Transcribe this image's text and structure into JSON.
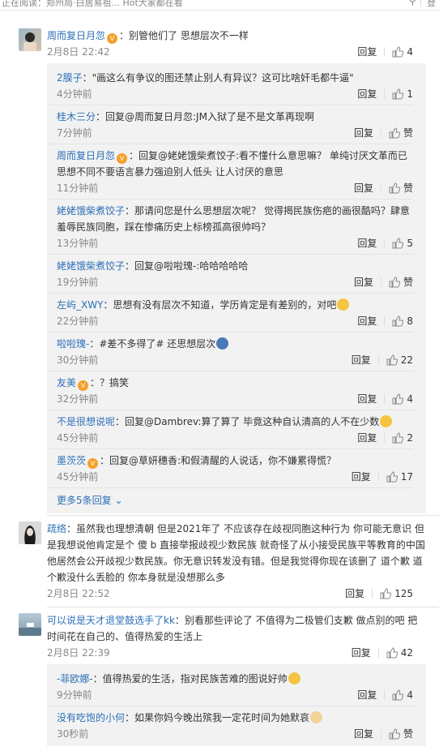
{
  "topbar": {
    "partial_title": "正在阅读：郑州局·白居易祖... Hot大家都在看",
    "right_label": "登"
  },
  "comments": [
    {
      "user": "周而复日月忽",
      "text": "：别管他们了 思想层次不一样",
      "time": "2月8日 22:42",
      "reply_label": "回复",
      "likes": "4",
      "replies": [
        {
          "user": "2膜子",
          "text": "：\"画这么有争议的图还禁止别人有异议？这可比啥奸毛都牛逼\"",
          "time": "4分钟前",
          "reply_label": "回复",
          "likes": "1"
        },
        {
          "user": "桂木三分",
          "text": "：回复@周而复日月忽:JM入狱了是不是文革再现啊",
          "time": "7分钟前",
          "reply_label": "回复",
          "likes": "赞"
        },
        {
          "user": "周而复日月忽",
          "text": "：回复@姥姥饿柴煮饺子:看不懂什么意思嘛？ 单纯讨厌文革而已 思想不同不要语言暴力强迫别人低头 让人讨厌的意思",
          "time": "11分钟前",
          "reply_label": "回复",
          "likes": "赞"
        },
        {
          "user": "姥姥饿柴煮饺子",
          "text": "：那请问您是什么思想层次呢？ 觉得揭民族伤疤的画很酷吗？肆意羞辱民族同胞，踩在惨痛历史上标榜孤高很帅吗？",
          "time": "13分钟前",
          "reply_label": "回复",
          "likes": "5"
        },
        {
          "user": "姥姥饿柴煮饺子",
          "text": "：回复@啦啦瑰-:哈哈哈哈哈",
          "time": "19分钟前",
          "reply_label": "回复",
          "likes": "赞"
        },
        {
          "user": "左屿_XWY",
          "text": "：思想有没有层次不知道，学历肯定是有差别的，对吧",
          "time": "22分钟前",
          "reply_label": "回复",
          "likes": "8"
        },
        {
          "user": "啦啦瑰-",
          "text": "：#差不多得了# 还思想层次",
          "time": "30分钟前",
          "reply_label": "回复",
          "likes": "22"
        },
        {
          "user": "友美",
          "text": "：？搞笑",
          "time": "32分钟前",
          "reply_label": "回复",
          "likes": "4"
        },
        {
          "user": "不是很想说呢",
          "text": "：回复@Dambrev:算了算了 毕竟这种自认清高的人不在少数",
          "time": "45分钟前",
          "reply_label": "回复",
          "likes": "2"
        },
        {
          "user": "墨茨茨",
          "text": "：回复@草妍穗香:和假清醒的人说话，你不嫌累得慌？",
          "time": "45分钟前",
          "reply_label": "回复",
          "likes": "17"
        }
      ],
      "more_label": "更多5条回复"
    },
    {
      "user": "疏络",
      "text": "：虽然我也理想清朝 但是2021年了 不应该存在歧视同胞这种行为 你可能无意识 但是我想说他肯定是个 傻 b 直接举报歧视少数民族 就奇怪了从小接受民族平等教育的中国他居然会公开歧视少数民族。你无意识转发没有错。但是我觉得你现在该删了 道个歉 道个歉没什么丢脸的 你本身就是没想那么多",
      "time": "2月8日 22:52",
      "reply_label": "回复",
      "likes": "125"
    },
    {
      "user": "可以说是天才退堂鼓选手了kk",
      "text": "：别看那些评论了 不值得为二极管们支歉 做点别的吧 把时间花在自己的、值得热爱的生活上",
      "time": "2月8日 22:39",
      "reply_label": "回复",
      "likes": "42",
      "replies": [
        {
          "user": "-菲欧娜-",
          "text": "：值得热爱的生活，指对民族苦难的图说好帅",
          "time": "9分钟前",
          "reply_label": "回复",
          "likes": "4"
        },
        {
          "user": "没有吃饱的小何",
          "text": "：如果你妈今晚出殡我一定花时间为她默哀",
          "time": "30秒前",
          "reply_label": "回复",
          "likes": "赞"
        }
      ]
    }
  ]
}
